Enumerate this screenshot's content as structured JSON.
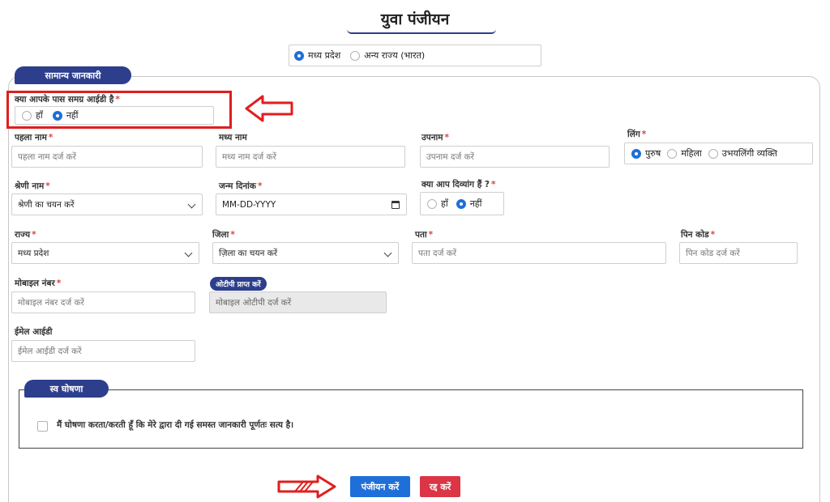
{
  "page": {
    "title": "युवा पंजीयन"
  },
  "state_choice": {
    "options": [
      {
        "label": "मध्य प्रदेश",
        "selected": true
      },
      {
        "label": "अन्य राज्य (भारत)",
        "selected": false
      }
    ]
  },
  "sections": {
    "general": "सामान्य जानकारी",
    "declaration": "स्व घोषणा"
  },
  "samagra": {
    "label": "क्या आपके पास समग्र आईडी है",
    "required": "*",
    "options": [
      {
        "label": "हाँ",
        "selected": false
      },
      {
        "label": "नहीं",
        "selected": true
      }
    ]
  },
  "fields": {
    "first_name": {
      "label": "पहला नाम",
      "required": "*",
      "placeholder": "पहला नाम दर्ज करें"
    },
    "middle_name": {
      "label": "मध्य नाम",
      "placeholder": "मध्य नाम दर्ज करें"
    },
    "last_name": {
      "label": "उपनाम",
      "required": "*",
      "placeholder": "उपनाम दर्ज करें"
    },
    "gender": {
      "label": "लिंग",
      "required": "*",
      "options": [
        {
          "label": "पुरुष",
          "selected": true
        },
        {
          "label": "महिला",
          "selected": false
        },
        {
          "label": "उभयलिंगी व्यक्ति",
          "selected": false
        }
      ]
    },
    "category": {
      "label": "श्रेणी नाम",
      "required": "*",
      "value": "श्रेणी का चयन करें"
    },
    "dob": {
      "label": "जन्म दिनांक",
      "required": "*",
      "value": "MM-DD-YYYY"
    },
    "disabled": {
      "label": "क्या आप दिव्यांग हैं ?",
      "required": "*",
      "options": [
        {
          "label": "हाँ",
          "selected": false
        },
        {
          "label": "नहीं",
          "selected": true
        }
      ]
    },
    "state": {
      "label": "राज्य",
      "required": "*",
      "value": "मध्य प्रदेश"
    },
    "district": {
      "label": "जिला",
      "required": "*",
      "value": "ज़िला का चयन करें"
    },
    "address": {
      "label": "पता",
      "required": "*",
      "placeholder": "पता दर्ज करें"
    },
    "pincode": {
      "label": "पिन कोड",
      "required": "*",
      "placeholder": "पिन कोड दर्ज करें"
    },
    "mobile": {
      "label": "मोबाइल नंबर",
      "required": "*",
      "placeholder": "मोबाइल नंबर दर्ज करें"
    },
    "otp": {
      "button": "ओटीपी प्राप्त करें",
      "placeholder": "मोबाइल ओटीपी दर्ज करें"
    },
    "email": {
      "label": "ईमेल आईडी",
      "placeholder": "ईमेल आईडी दर्ज करें"
    }
  },
  "declaration": {
    "text": "मैं घोषणा करता/करती हूँ कि मेरे द्वारा दी गई समस्त जानकारी पूर्णतः सत्य है।"
  },
  "actions": {
    "register": "पंजीयन करें",
    "cancel": "रद्द करें"
  },
  "colors": {
    "brand": "#2d3e8c",
    "primary": "#1e6fd9",
    "danger": "#dc3545",
    "annotation": "#e01e1e"
  }
}
